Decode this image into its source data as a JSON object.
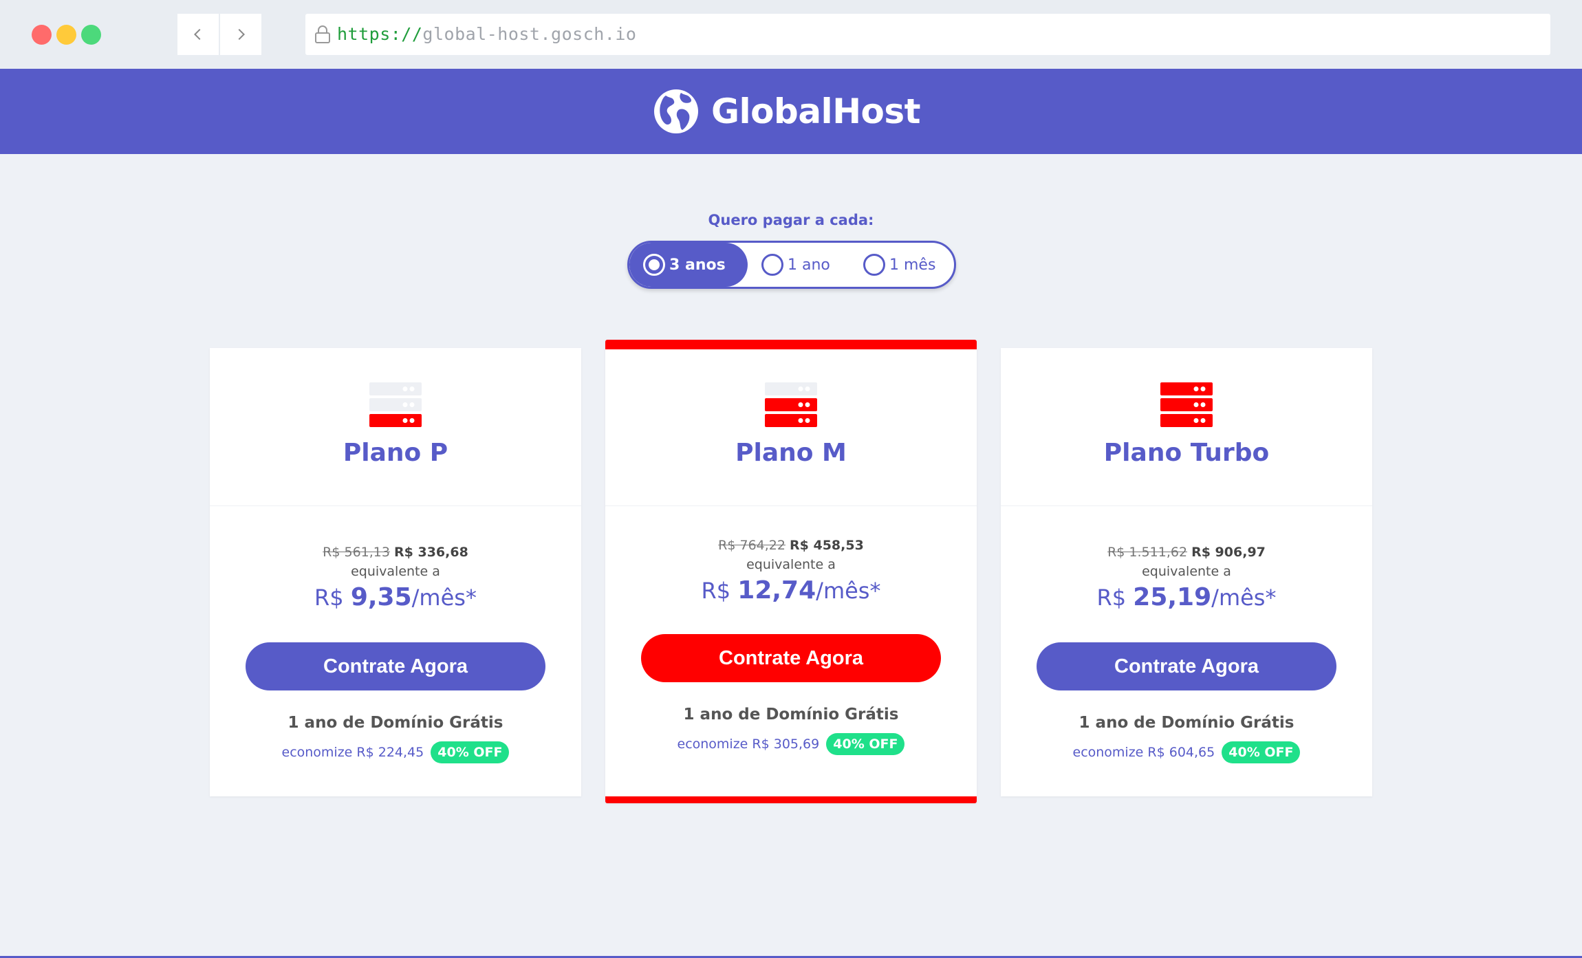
{
  "browser": {
    "url_scheme": "https://",
    "url_host": "global-host.gosch.io"
  },
  "header": {
    "brand": "GlobalHost"
  },
  "billing": {
    "label": "Quero pagar a cada:",
    "options": [
      {
        "label": "3 anos",
        "selected": true
      },
      {
        "label": "1 ano",
        "selected": false
      },
      {
        "label": "1 mês",
        "selected": false
      }
    ]
  },
  "plans": [
    {
      "name": "Plano P",
      "old_price": "R$ 561,13",
      "new_price": "R$ 336,68",
      "equiv": "equivalente a",
      "currency": "R$",
      "monthly": "9,35",
      "per": "/mês*",
      "cta": "Contrate Agora",
      "domain": "1 ano de Domínio Grátis",
      "save": "economize R$ 224,45",
      "badge": "40% OFF",
      "server_level": 1
    },
    {
      "name": "Plano M",
      "old_price": "R$ 764,22",
      "new_price": "R$ 458,53",
      "equiv": "equivalente a",
      "currency": "R$",
      "monthly": "12,74",
      "per": "/mês*",
      "cta": "Contrate Agora",
      "domain": "1 ano de Domínio Grátis",
      "save": "economize R$ 305,69",
      "badge": "40% OFF",
      "server_level": 2,
      "featured": true
    },
    {
      "name": "Plano Turbo",
      "old_price": "R$ 1.511,62",
      "new_price": "R$ 906,97",
      "equiv": "equivalente a",
      "currency": "R$",
      "monthly": "25,19",
      "per": "/mês*",
      "cta": "Contrate Agora",
      "domain": "1 ano de Domínio Grátis",
      "save": "economize R$ 604,65",
      "badge": "40% OFF",
      "server_level": 3
    }
  ],
  "colors": {
    "primary": "#575bc8",
    "accent": "#ff0000",
    "success": "#1fe08a",
    "background": "#eef1f6"
  }
}
